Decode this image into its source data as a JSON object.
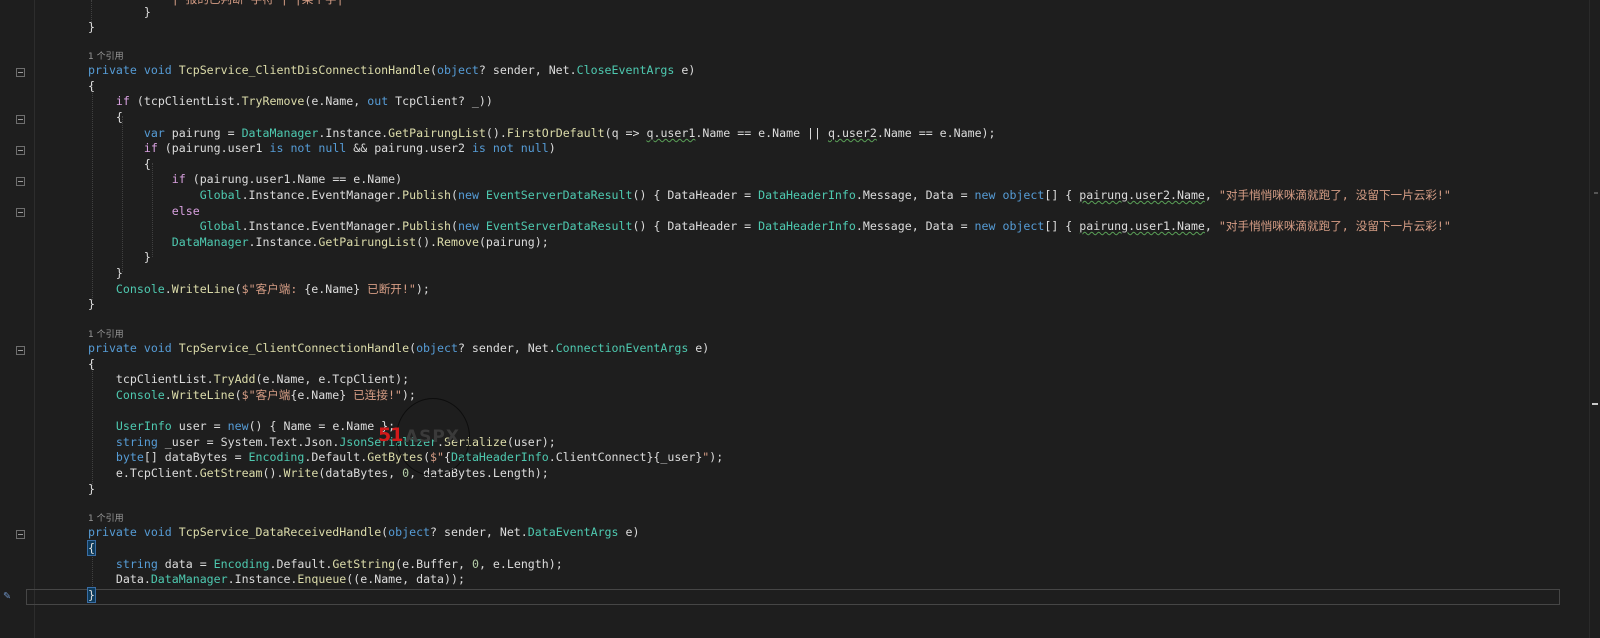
{
  "editor": {
    "references": [
      "1 个引用",
      "1 个引用",
      "1 个引用"
    ],
    "lines": [
      [
        [
          "            ",
          "p"
        ],
        [
          "| 报的已判断 字符 | |某个字|",
          "str"
        ]
      ],
      [
        [
          "        }",
          "p"
        ]
      ],
      [
        [
          "}",
          "p"
        ]
      ],
      [],
      [
        [
          "private ",
          "kw"
        ],
        [
          "void ",
          "kw"
        ],
        [
          "TcpService_ClientDisConnectionHandle",
          "mth"
        ],
        [
          "(",
          "p"
        ],
        [
          "object",
          "kw"
        ],
        [
          "? sender, Net.",
          "p"
        ],
        [
          "CloseEventArgs",
          "typ"
        ],
        [
          " e)",
          "p"
        ]
      ],
      [
        [
          "{",
          "p"
        ]
      ],
      [
        [
          "    ",
          "p"
        ],
        [
          "if ",
          "ctl"
        ],
        [
          "(tcpClientList.",
          "p"
        ],
        [
          "TryRemove",
          "mth"
        ],
        [
          "(e.Name, ",
          "p"
        ],
        [
          "out ",
          "kw"
        ],
        [
          "TcpClient? _))",
          "p"
        ]
      ],
      [
        [
          "    {",
          "p"
        ]
      ],
      [
        [
          "        ",
          "p"
        ],
        [
          "var ",
          "kw"
        ],
        [
          "pairung = ",
          "p"
        ],
        [
          "DataManager",
          "typ"
        ],
        [
          ".Instance.",
          "p"
        ],
        [
          "GetPairungList",
          "mth"
        ],
        [
          "().",
          "p"
        ],
        [
          "FirstOrDefault",
          "mth"
        ],
        [
          "(q => ",
          "p"
        ],
        [
          "q.user1",
          "p sq"
        ],
        [
          ".Name == e.Name || ",
          "p"
        ],
        [
          "q.user2",
          "p sq"
        ],
        [
          ".Name == e.Name);",
          "p"
        ]
      ],
      [
        [
          "        ",
          "p"
        ],
        [
          "if ",
          "ctl"
        ],
        [
          "(pairung.user1 ",
          "p"
        ],
        [
          "is not null ",
          "kw"
        ],
        [
          "&& pairung.user2 ",
          "p"
        ],
        [
          "is not null",
          "kw"
        ],
        [
          ")",
          "p"
        ]
      ],
      [
        [
          "        {",
          "p"
        ]
      ],
      [
        [
          "            ",
          "p"
        ],
        [
          "if ",
          "ctl"
        ],
        [
          "(pairung.user1.Name == e.Name)",
          "p"
        ]
      ],
      [
        [
          "                ",
          "p"
        ],
        [
          "Global",
          "typ"
        ],
        [
          ".Instance.EventManager.",
          "p"
        ],
        [
          "Publish",
          "mth"
        ],
        [
          "(",
          "p"
        ],
        [
          "new ",
          "kw"
        ],
        [
          "EventServerDataResult",
          "typ"
        ],
        [
          "() { DataHeader = ",
          "p"
        ],
        [
          "DataHeaderInfo",
          "typ"
        ],
        [
          ".Message, Data = ",
          "p"
        ],
        [
          "new ",
          "kw"
        ],
        [
          "object",
          "kw"
        ],
        [
          "[] { ",
          "p"
        ],
        [
          "pairung.user2.Name",
          "p sq"
        ],
        [
          ", ",
          "p"
        ],
        [
          "\"对手悄悄咪咪滴就跑了, 没留下一片云彩!\"",
          "str"
        ]
      ],
      [
        [
          "            ",
          "p"
        ],
        [
          "else",
          "ctl"
        ]
      ],
      [
        [
          "                ",
          "p"
        ],
        [
          "Global",
          "typ"
        ],
        [
          ".Instance.EventManager.",
          "p"
        ],
        [
          "Publish",
          "mth"
        ],
        [
          "(",
          "p"
        ],
        [
          "new ",
          "kw"
        ],
        [
          "EventServerDataResult",
          "typ"
        ],
        [
          "() { DataHeader = ",
          "p"
        ],
        [
          "DataHeaderInfo",
          "typ"
        ],
        [
          ".Message, Data = ",
          "p"
        ],
        [
          "new ",
          "kw"
        ],
        [
          "object",
          "kw"
        ],
        [
          "[] { ",
          "p"
        ],
        [
          "pairung.user1.Name",
          "p sq"
        ],
        [
          ", ",
          "p"
        ],
        [
          "\"对手悄悄咪咪滴就跑了, 没留下一片云彩!\"",
          "str"
        ]
      ],
      [
        [
          "            ",
          "p"
        ],
        [
          "DataManager",
          "typ"
        ],
        [
          ".Instance.",
          "p"
        ],
        [
          "GetPairungList",
          "mth"
        ],
        [
          "().",
          "p"
        ],
        [
          "Remove",
          "mth"
        ],
        [
          "(pairung);",
          "p"
        ]
      ],
      [
        [
          "        }",
          "p"
        ]
      ],
      [
        [
          "    }",
          "p"
        ]
      ],
      [
        [
          "    ",
          "p"
        ],
        [
          "Console",
          "typ"
        ],
        [
          ".",
          "p"
        ],
        [
          "WriteLine",
          "mth"
        ],
        [
          "(",
          "p"
        ],
        [
          "$\"客户端: ",
          "str"
        ],
        [
          "{e.Name}",
          "p"
        ],
        [
          " 已断开!\"",
          "str"
        ],
        [
          ");",
          "p"
        ]
      ],
      [
        [
          "}",
          "p"
        ]
      ],
      [],
      [
        [
          "private ",
          "kw"
        ],
        [
          "void ",
          "kw"
        ],
        [
          "TcpService_ClientConnectionHandle",
          "mth"
        ],
        [
          "(",
          "p"
        ],
        [
          "object",
          "kw"
        ],
        [
          "? sender, Net.",
          "p"
        ],
        [
          "ConnectionEventArgs",
          "typ"
        ],
        [
          " e)",
          "p"
        ]
      ],
      [
        [
          "{",
          "p"
        ]
      ],
      [
        [
          "    tcpClientList.",
          "p"
        ],
        [
          "TryAdd",
          "mth"
        ],
        [
          "(e.Name, e.TcpClient);",
          "p"
        ]
      ],
      [
        [
          "    ",
          "p"
        ],
        [
          "Console",
          "typ"
        ],
        [
          ".",
          "p"
        ],
        [
          "WriteLine",
          "mth"
        ],
        [
          "(",
          "p"
        ],
        [
          "$\"客户端",
          "str"
        ],
        [
          "{e.Name}",
          "p"
        ],
        [
          " 已连接!\"",
          "str"
        ],
        [
          ");",
          "p"
        ]
      ],
      [],
      [
        [
          "    ",
          "p"
        ],
        [
          "UserInfo",
          "typ"
        ],
        [
          " user = ",
          "p"
        ],
        [
          "new",
          "kw"
        ],
        [
          "() { Name = e.Name };",
          "p"
        ]
      ],
      [
        [
          "    ",
          "p"
        ],
        [
          "string ",
          "kw"
        ],
        [
          "_user = System.Text.Json.",
          "p"
        ],
        [
          "JsonSerializer",
          "typ"
        ],
        [
          ".",
          "p"
        ],
        [
          "Serialize",
          "mth"
        ],
        [
          "(user);",
          "p"
        ]
      ],
      [
        [
          "    ",
          "p"
        ],
        [
          "byte",
          "kw"
        ],
        [
          "[] dataBytes = ",
          "p"
        ],
        [
          "Encoding",
          "typ"
        ],
        [
          ".Default.",
          "p"
        ],
        [
          "GetBytes",
          "mth"
        ],
        [
          "(",
          "p"
        ],
        [
          "$\"",
          "str"
        ],
        [
          "{",
          "p"
        ],
        [
          "DataHeaderInfo",
          "typ"
        ],
        [
          ".ClientConnect}{_user}",
          "p"
        ],
        [
          "\"",
          "str"
        ],
        [
          ");",
          "p"
        ]
      ],
      [
        [
          "    e.TcpClient.",
          "p"
        ],
        [
          "GetStream",
          "mth"
        ],
        [
          "().",
          "p"
        ],
        [
          "Write",
          "mth"
        ],
        [
          "(dataBytes, ",
          "p"
        ],
        [
          "0",
          "num"
        ],
        [
          ", dataBytes.Length);",
          "p"
        ]
      ],
      [
        [
          "}",
          "p"
        ]
      ],
      [],
      [
        [
          "private ",
          "kw"
        ],
        [
          "void ",
          "kw"
        ],
        [
          "TcpService_DataReceivedHandle",
          "mth"
        ],
        [
          "(",
          "p"
        ],
        [
          "object",
          "kw"
        ],
        [
          "? sender, Net.",
          "p"
        ],
        [
          "DataEventArgs",
          "typ"
        ],
        [
          " e)",
          "p"
        ]
      ],
      [
        [
          "{",
          "p brh"
        ]
      ],
      [
        [
          "    ",
          "p"
        ],
        [
          "string ",
          "kw"
        ],
        [
          "data = ",
          "p"
        ],
        [
          "Encoding",
          "typ"
        ],
        [
          ".Default.",
          "p"
        ],
        [
          "GetString",
          "mth"
        ],
        [
          "(e.Buffer, ",
          "p"
        ],
        [
          "0",
          "num"
        ],
        [
          ", e.Length);",
          "p"
        ]
      ],
      [
        [
          "    Data.",
          "p"
        ],
        [
          "DataManager",
          "typ"
        ],
        [
          ".Instance.",
          "p"
        ],
        [
          "Enqueue",
          "mth"
        ],
        [
          "((e.Name, data));",
          "p"
        ]
      ],
      [
        [
          "}",
          "p brh"
        ]
      ]
    ]
  },
  "watermark": {
    "brand_red": "51",
    "brand_gray": "ASPX"
  },
  "colors": {
    "background": "#1e1e1e",
    "keyword": "#569cd6",
    "type": "#4ec9b0",
    "method": "#dcdcaa",
    "string": "#d69d85"
  }
}
